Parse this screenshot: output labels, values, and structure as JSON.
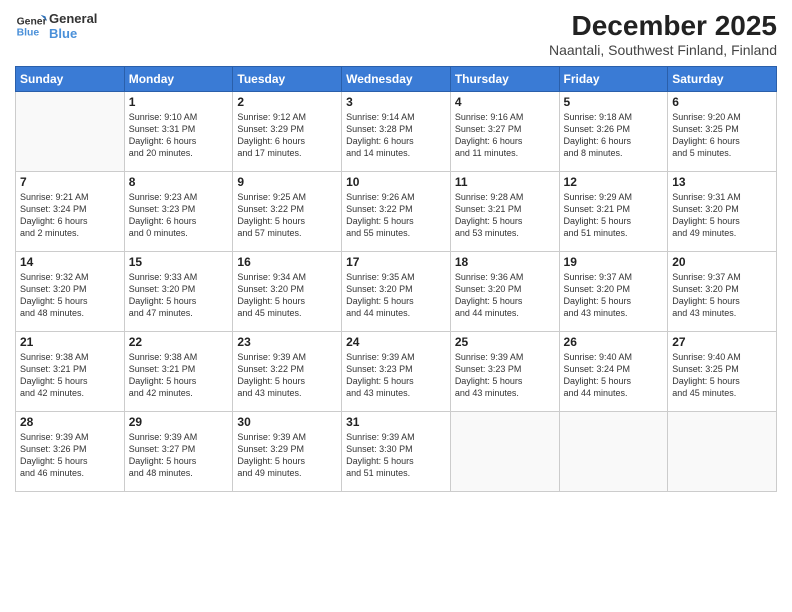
{
  "logo": {
    "line1": "General",
    "line2": "Blue"
  },
  "title": "December 2025",
  "subtitle": "Naantali, Southwest Finland, Finland",
  "days_of_week": [
    "Sunday",
    "Monday",
    "Tuesday",
    "Wednesday",
    "Thursday",
    "Friday",
    "Saturday"
  ],
  "weeks": [
    [
      {
        "day": "",
        "info": ""
      },
      {
        "day": "1",
        "info": "Sunrise: 9:10 AM\nSunset: 3:31 PM\nDaylight: 6 hours\nand 20 minutes."
      },
      {
        "day": "2",
        "info": "Sunrise: 9:12 AM\nSunset: 3:29 PM\nDaylight: 6 hours\nand 17 minutes."
      },
      {
        "day": "3",
        "info": "Sunrise: 9:14 AM\nSunset: 3:28 PM\nDaylight: 6 hours\nand 14 minutes."
      },
      {
        "day": "4",
        "info": "Sunrise: 9:16 AM\nSunset: 3:27 PM\nDaylight: 6 hours\nand 11 minutes."
      },
      {
        "day": "5",
        "info": "Sunrise: 9:18 AM\nSunset: 3:26 PM\nDaylight: 6 hours\nand 8 minutes."
      },
      {
        "day": "6",
        "info": "Sunrise: 9:20 AM\nSunset: 3:25 PM\nDaylight: 6 hours\nand 5 minutes."
      }
    ],
    [
      {
        "day": "7",
        "info": "Sunrise: 9:21 AM\nSunset: 3:24 PM\nDaylight: 6 hours\nand 2 minutes."
      },
      {
        "day": "8",
        "info": "Sunrise: 9:23 AM\nSunset: 3:23 PM\nDaylight: 6 hours\nand 0 minutes."
      },
      {
        "day": "9",
        "info": "Sunrise: 9:25 AM\nSunset: 3:22 PM\nDaylight: 5 hours\nand 57 minutes."
      },
      {
        "day": "10",
        "info": "Sunrise: 9:26 AM\nSunset: 3:22 PM\nDaylight: 5 hours\nand 55 minutes."
      },
      {
        "day": "11",
        "info": "Sunrise: 9:28 AM\nSunset: 3:21 PM\nDaylight: 5 hours\nand 53 minutes."
      },
      {
        "day": "12",
        "info": "Sunrise: 9:29 AM\nSunset: 3:21 PM\nDaylight: 5 hours\nand 51 minutes."
      },
      {
        "day": "13",
        "info": "Sunrise: 9:31 AM\nSunset: 3:20 PM\nDaylight: 5 hours\nand 49 minutes."
      }
    ],
    [
      {
        "day": "14",
        "info": "Sunrise: 9:32 AM\nSunset: 3:20 PM\nDaylight: 5 hours\nand 48 minutes."
      },
      {
        "day": "15",
        "info": "Sunrise: 9:33 AM\nSunset: 3:20 PM\nDaylight: 5 hours\nand 47 minutes."
      },
      {
        "day": "16",
        "info": "Sunrise: 9:34 AM\nSunset: 3:20 PM\nDaylight: 5 hours\nand 45 minutes."
      },
      {
        "day": "17",
        "info": "Sunrise: 9:35 AM\nSunset: 3:20 PM\nDaylight: 5 hours\nand 44 minutes."
      },
      {
        "day": "18",
        "info": "Sunrise: 9:36 AM\nSunset: 3:20 PM\nDaylight: 5 hours\nand 44 minutes."
      },
      {
        "day": "19",
        "info": "Sunrise: 9:37 AM\nSunset: 3:20 PM\nDaylight: 5 hours\nand 43 minutes."
      },
      {
        "day": "20",
        "info": "Sunrise: 9:37 AM\nSunset: 3:20 PM\nDaylight: 5 hours\nand 43 minutes."
      }
    ],
    [
      {
        "day": "21",
        "info": "Sunrise: 9:38 AM\nSunset: 3:21 PM\nDaylight: 5 hours\nand 42 minutes."
      },
      {
        "day": "22",
        "info": "Sunrise: 9:38 AM\nSunset: 3:21 PM\nDaylight: 5 hours\nand 42 minutes."
      },
      {
        "day": "23",
        "info": "Sunrise: 9:39 AM\nSunset: 3:22 PM\nDaylight: 5 hours\nand 43 minutes."
      },
      {
        "day": "24",
        "info": "Sunrise: 9:39 AM\nSunset: 3:23 PM\nDaylight: 5 hours\nand 43 minutes."
      },
      {
        "day": "25",
        "info": "Sunrise: 9:39 AM\nSunset: 3:23 PM\nDaylight: 5 hours\nand 43 minutes."
      },
      {
        "day": "26",
        "info": "Sunrise: 9:40 AM\nSunset: 3:24 PM\nDaylight: 5 hours\nand 44 minutes."
      },
      {
        "day": "27",
        "info": "Sunrise: 9:40 AM\nSunset: 3:25 PM\nDaylight: 5 hours\nand 45 minutes."
      }
    ],
    [
      {
        "day": "28",
        "info": "Sunrise: 9:39 AM\nSunset: 3:26 PM\nDaylight: 5 hours\nand 46 minutes."
      },
      {
        "day": "29",
        "info": "Sunrise: 9:39 AM\nSunset: 3:27 PM\nDaylight: 5 hours\nand 48 minutes."
      },
      {
        "day": "30",
        "info": "Sunrise: 9:39 AM\nSunset: 3:29 PM\nDaylight: 5 hours\nand 49 minutes."
      },
      {
        "day": "31",
        "info": "Sunrise: 9:39 AM\nSunset: 3:30 PM\nDaylight: 5 hours\nand 51 minutes."
      },
      {
        "day": "",
        "info": ""
      },
      {
        "day": "",
        "info": ""
      },
      {
        "day": "",
        "info": ""
      }
    ]
  ]
}
